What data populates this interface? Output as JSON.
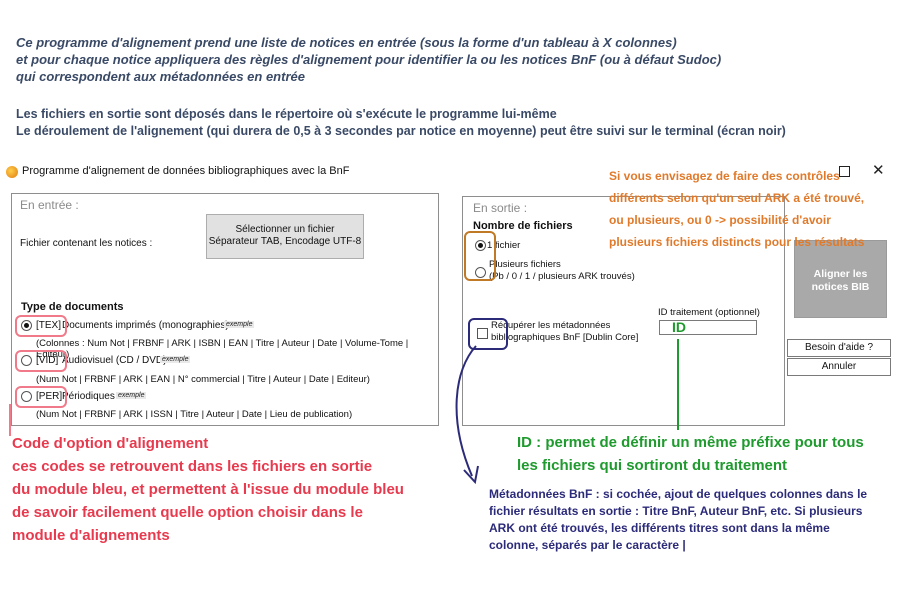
{
  "intro": {
    "line1": "Ce programme d'alignement prend une liste de notices en entrée (sous la forme d'un tableau à X colonnes)",
    "line2": "et pour chaque notice appliquera des règles d'alignement pour identifier la ou les notices BnF (ou à défaut Sudoc)",
    "line3": "qui correspondent aux métadonnées en entrée"
  },
  "note": {
    "line1": "Les fichiers en sortie sont déposés dans le répertoire où s'exécute le programme lui-même",
    "line2": "Le déroulement de l'alignement (qui durera de 0,5 à 3 secondes par notice en moyenne) peut être suivi sur le terminal (écran noir)"
  },
  "window": {
    "title": "Programme d'alignement de données bibliographiques avec la BnF",
    "close_glyph": "✕"
  },
  "entree": {
    "legend": "En entrée :",
    "file_label": "Fichier contenant les notices :",
    "select_button_line1": "Sélectionner un fichier",
    "select_button_line2": "Séparateur TAB, Encodage UTF-8",
    "doc_type_title": "Type de documents",
    "example_label": "exemple",
    "options": [
      {
        "code": "[TEX]",
        "label": "Documents imprimés (monographies)",
        "columns": "(Colonnes : Num Not | FRBNF | ARK | ISBN | EAN | Titre | Auteur | Date | Volume-Tome | Editeur)",
        "selected": true
      },
      {
        "code": "[VID]",
        "label": "Audiovisuel (CD / DVD)",
        "columns": "(Num Not | FRBNF | ARK | EAN | N° commercial | Titre | Auteur | Date | Editeur)",
        "selected": false
      },
      {
        "code": "[PER]",
        "label": "Périodiques",
        "columns": "(Num Not | FRBNF | ARK | ISSN | Titre | Auteur | Date | Lieu de publication)",
        "selected": false
      }
    ]
  },
  "sortie": {
    "legend": "En sortie :",
    "files_title": "Nombre de fichiers",
    "option1": "1 fichier",
    "option2_line1": "Plusieurs fichiers",
    "option2_line2": "(Pb / 0 / 1 / plusieurs ARK trouvés)",
    "metadata_line1": "Récupérer les métadonnées",
    "metadata_line2": "bibliographiques BnF [Dublin Core]",
    "id_label": "ID traitement (optionnel)",
    "id_value": "ID"
  },
  "buttons": {
    "align_line1": "Aligner les",
    "align_line2": "notices BIB",
    "help": "Besoin d'aide ?",
    "cancel": "Annuler"
  },
  "annotations": {
    "orange": [
      "Si vous envisagez de faire des contrôles",
      "différents selon qu'un seul ARK a été trouvé,",
      "ou plusieurs, ou 0 -> possibilité d'avoir",
      "plusieurs fichiers distincts pour les résultats"
    ],
    "red": [
      "Code d'option d'alignement",
      "ces codes se retrouvent dans les fichiers en sortie",
      "du module bleu, et permettent à l'issue du module bleu",
      "de savoir facilement quelle option choisir dans le",
      "module d'alignements"
    ],
    "green": [
      "ID : permet de définir un même préfixe pour tous",
      "les fichiers qui sortiront du traitement"
    ],
    "navy": [
      "Métadonnées BnF : si cochée, ajout de quelques colonnes dans le",
      "fichier résultats en sortie : Titre BnF, Auteur BnF, etc. Si plusieurs",
      "ARK ont été trouvés, les différents titres sont dans la même",
      "colonne, séparés par le caractère |"
    ]
  },
  "colors": {
    "pink": "#f07a8a",
    "orange": "#e07a2a",
    "navy": "#2c2b7a",
    "green": "#1f9a2e",
    "red": "#e83a4e"
  }
}
